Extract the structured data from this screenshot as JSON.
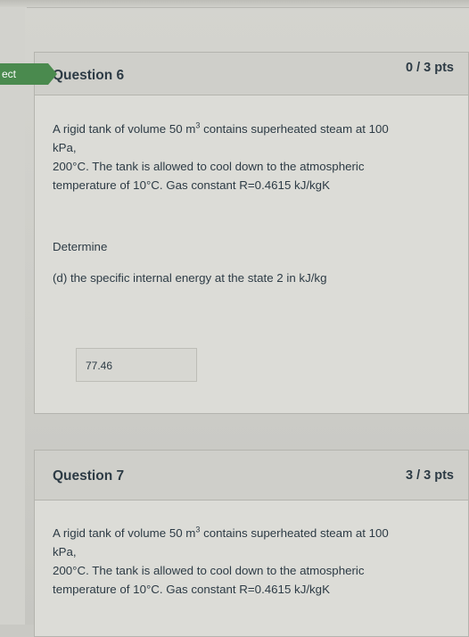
{
  "flag": {
    "label": "ect"
  },
  "questions": [
    {
      "title": "Question 6",
      "points": "0 / 3 pts",
      "line1_a": "A rigid tank of volume 50 m",
      "line1_sup": "3",
      "line1_b": " contains superheated steam at 100",
      "line2": "kPa,",
      "line3": "200°C. The tank is allowed to cool down to the atmospheric",
      "line4": "temperature of 10°C. Gas constant R=0.4615 kJ/kgK",
      "determine": "Determine",
      "part": "(d) the specific internal energy at the state 2 in kJ/kg",
      "answer": "77.46"
    },
    {
      "title": "Question 7",
      "points": "3 / 3 pts",
      "line1_a": "A rigid tank of volume 50 m",
      "line1_sup": "3",
      "line1_b": " contains superheated steam at 100",
      "line2": "kPa,",
      "line3": "200°C. The tank is allowed to cool down to the atmospheric",
      "line4": "temperature of 10°C. Gas constant R=0.4615 kJ/kgK"
    }
  ]
}
